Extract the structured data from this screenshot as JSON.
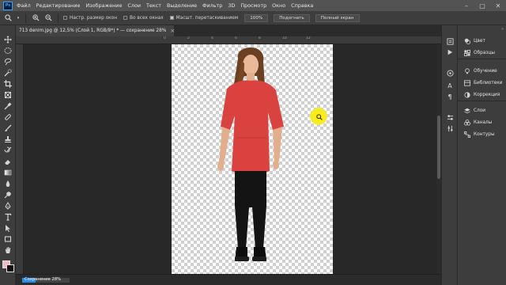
{
  "app": {
    "logo_text": "Ps",
    "menu": [
      "Файл",
      "Редактирование",
      "Изображение",
      "Слои",
      "Текст",
      "Выделение",
      "Фильтр",
      "3D",
      "Просмотр",
      "Окно",
      "Справка"
    ]
  },
  "options_bar": {
    "checkboxes": [
      {
        "label": "Настр. размер окон",
        "checked": false
      },
      {
        "label": "Во всех окнах",
        "checked": false
      },
      {
        "label": "Масшт. перетаскиванием",
        "checked": true
      }
    ],
    "buttons": [
      "100%",
      "Подогнать",
      "Полный экран"
    ]
  },
  "document": {
    "tab_title": "713 denim.jpg @ 12,5% (Слой 1, RGB/8*) * — сохранение 28%",
    "close_symbol": "×"
  },
  "ruler": {
    "top_ticks": [
      "0",
      "2",
      "4",
      "6",
      "8",
      "10",
      "12"
    ]
  },
  "status": {
    "progress_label": "Сохранение 28%",
    "progress_percent": 28
  },
  "panels": {
    "group1": [
      "Цвет",
      "Образцы"
    ],
    "group2": [
      "Обучение",
      "Библиотеки",
      "Коррекция"
    ],
    "group3": [
      "Слои",
      "Каналы",
      "Контуры"
    ]
  },
  "colors": {
    "accent": "#2d8ceb",
    "foreground": "#f4b9c4",
    "background": "#111111"
  }
}
